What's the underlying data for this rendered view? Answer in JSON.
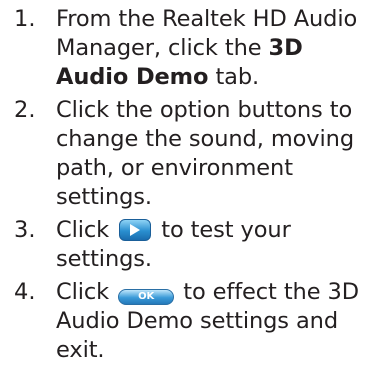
{
  "steps": [
    {
      "number": "1.",
      "text_before": "From the Realtek HD Audio Manager, click the ",
      "bold_text": "3D Audio Demo",
      "text_after": " tab."
    },
    {
      "number": "2.",
      "text": "Click the option buttons to change the sound, moving path, or environment settings."
    },
    {
      "number": "3.",
      "text_before": "Click ",
      "icon": "play-button-icon",
      "text_after": " to test your settings."
    },
    {
      "number": "4.",
      "text_before": "Click ",
      "button_label": "OK",
      "text_after": " to effect the 3D Audio Demo settings and exit."
    }
  ],
  "colors": {
    "text": "#231f20",
    "button_blue": "#2a8fd0"
  }
}
